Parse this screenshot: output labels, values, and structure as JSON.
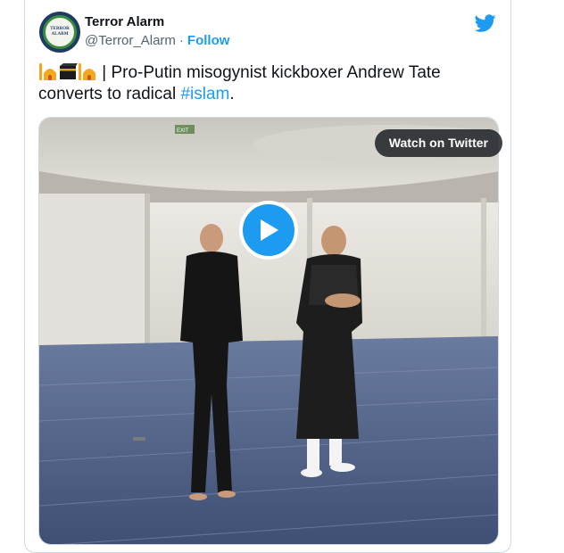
{
  "tweet": {
    "author_name": "Terror Alarm",
    "author_handle": "@Terror_Alarm",
    "separator": "·",
    "follow_label": "Follow",
    "avatar_text_top": "TERROR ALARM",
    "avatar_text_mid": "TERROR",
    "avatar_text_bot": "ALARM",
    "text_before_hashtag": " | Pro-Putin misogynist kickboxer Andrew Tate converts to radical ",
    "hashtag": "#islam",
    "text_after_hashtag": ".",
    "emojis": [
      "mosque-icon",
      "kaaba-icon",
      "mosque-icon"
    ]
  },
  "media": {
    "watch_label": "Watch on Twitter",
    "exit_sign": "EXIT",
    "play_icon": "play-icon"
  },
  "colors": {
    "accent": "#1d9bf0",
    "text": "#0f1419",
    "muted": "#536471",
    "border": "#cfd9de",
    "carpet": "#4b5d82"
  },
  "icons": {
    "brand": "twitter-bird-icon"
  }
}
